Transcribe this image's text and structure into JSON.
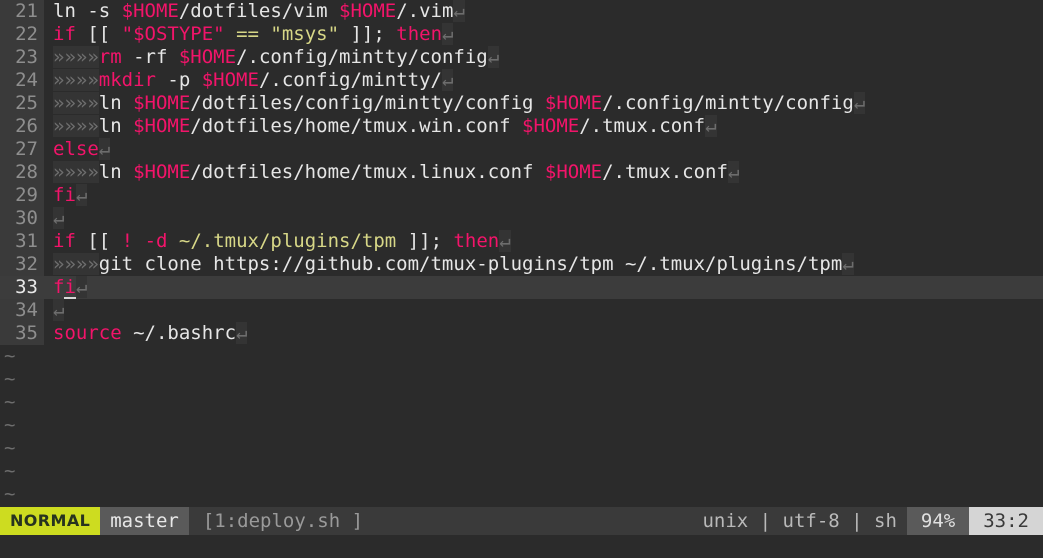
{
  "editor": {
    "name": "vim",
    "colors": {
      "background": "#2b2b2b",
      "gutter_background": "#3a3a3a",
      "cursorline_background": "#3c3c3c",
      "keyword": "#f2146a",
      "variable": "#f2146a",
      "string": "#d7d787",
      "plain_text": "#e6e6e6",
      "line_number": "#8e8e8e",
      "whitespace_marker": "#6e6e6e",
      "statusline_background": "#3a3a3a",
      "mode_background": "#cddc20",
      "mode_text": "#27331f"
    },
    "indent_marker": "»",
    "eol_marker": "↵",
    "tilde_marker": "~",
    "tilde_line_count": 7,
    "cursor_line_number": 33
  },
  "buffer": {
    "lines": [
      {
        "number": "21",
        "cursorline": false,
        "tokens": [
          {
            "text": "ln -s ",
            "type": "plain"
          },
          {
            "text": "$HOME",
            "type": "var"
          },
          {
            "text": "/dotfiles/vim ",
            "type": "plain"
          },
          {
            "text": "$HOME",
            "type": "var"
          },
          {
            "text": "/.vim",
            "type": "plain"
          },
          {
            "text": "↵",
            "type": "eol"
          }
        ]
      },
      {
        "number": "22",
        "cursorline": false,
        "tokens": [
          {
            "text": "if",
            "type": "kw"
          },
          {
            "text": " [[ ",
            "type": "plain"
          },
          {
            "text": "\"$OSTYPE\"",
            "type": "var"
          },
          {
            "text": " ",
            "type": "plain"
          },
          {
            "text": "==",
            "type": "op"
          },
          {
            "text": " ",
            "type": "plain"
          },
          {
            "text": "\"msys\"",
            "type": "str"
          },
          {
            "text": " ]]; ",
            "type": "plain"
          },
          {
            "text": "then",
            "type": "kw"
          },
          {
            "text": "↵",
            "type": "eol"
          }
        ]
      },
      {
        "number": "23",
        "cursorline": false,
        "tokens": [
          {
            "text": "»»»»",
            "type": "indent"
          },
          {
            "text": "rm",
            "type": "kw"
          },
          {
            "text": " -rf ",
            "type": "plain"
          },
          {
            "text": "$HOME",
            "type": "var"
          },
          {
            "text": "/.config/mintty/config",
            "type": "plain"
          },
          {
            "text": "↵",
            "type": "eol"
          }
        ]
      },
      {
        "number": "24",
        "cursorline": false,
        "tokens": [
          {
            "text": "»»»»",
            "type": "indent"
          },
          {
            "text": "mkdir",
            "type": "kw"
          },
          {
            "text": " -p ",
            "type": "plain"
          },
          {
            "text": "$HOME",
            "type": "var"
          },
          {
            "text": "/.config/mintty/",
            "type": "plain"
          },
          {
            "text": "↵",
            "type": "eol"
          }
        ]
      },
      {
        "number": "25",
        "cursorline": false,
        "tokens": [
          {
            "text": "»»»»",
            "type": "indent"
          },
          {
            "text": "ln ",
            "type": "plain"
          },
          {
            "text": "$HOME",
            "type": "var"
          },
          {
            "text": "/dotfiles/config/mintty/config ",
            "type": "plain"
          },
          {
            "text": "$HOME",
            "type": "var"
          },
          {
            "text": "/.config/mintty/config",
            "type": "plain"
          },
          {
            "text": "↵",
            "type": "eol"
          }
        ]
      },
      {
        "number": "26",
        "cursorline": false,
        "tokens": [
          {
            "text": "»»»»",
            "type": "indent"
          },
          {
            "text": "ln ",
            "type": "plain"
          },
          {
            "text": "$HOME",
            "type": "var"
          },
          {
            "text": "/dotfiles/home/tmux.win.conf ",
            "type": "plain"
          },
          {
            "text": "$HOME",
            "type": "var"
          },
          {
            "text": "/.tmux.conf",
            "type": "plain"
          },
          {
            "text": "↵",
            "type": "eol"
          }
        ]
      },
      {
        "number": "27",
        "cursorline": false,
        "tokens": [
          {
            "text": "else",
            "type": "kw"
          },
          {
            "text": "↵",
            "type": "eol"
          }
        ]
      },
      {
        "number": "28",
        "cursorline": false,
        "tokens": [
          {
            "text": "»»»»",
            "type": "indent"
          },
          {
            "text": "ln ",
            "type": "plain"
          },
          {
            "text": "$HOME",
            "type": "var"
          },
          {
            "text": "/dotfiles/home/tmux.linux.conf ",
            "type": "plain"
          },
          {
            "text": "$HOME",
            "type": "var"
          },
          {
            "text": "/.tmux.conf",
            "type": "plain"
          },
          {
            "text": "↵",
            "type": "eol"
          }
        ]
      },
      {
        "number": "29",
        "cursorline": false,
        "tokens": [
          {
            "text": "fi",
            "type": "kw"
          },
          {
            "text": "↵",
            "type": "eol"
          }
        ]
      },
      {
        "number": "30",
        "cursorline": false,
        "tokens": [
          {
            "text": "↵",
            "type": "eol"
          }
        ]
      },
      {
        "number": "31",
        "cursorline": false,
        "tokens": [
          {
            "text": "if",
            "type": "kw"
          },
          {
            "text": " [[ ",
            "type": "plain"
          },
          {
            "text": "!",
            "type": "kw"
          },
          {
            "text": " ",
            "type": "plain"
          },
          {
            "text": "-d",
            "type": "kw"
          },
          {
            "text": " ",
            "type": "plain"
          },
          {
            "text": "~/.tmux/plugins/tpm",
            "type": "str"
          },
          {
            "text": " ]]; ",
            "type": "plain"
          },
          {
            "text": "then",
            "type": "kw"
          },
          {
            "text": "↵",
            "type": "eol"
          }
        ]
      },
      {
        "number": "32",
        "cursorline": false,
        "tokens": [
          {
            "text": "»»»»",
            "type": "indent"
          },
          {
            "text": "git clone https://github.com/tmux-plugins/tpm ~/.tmux/plugins/tpm",
            "type": "plain"
          },
          {
            "text": "↵",
            "type": "eol"
          }
        ]
      },
      {
        "number": "33",
        "cursorline": true,
        "tokens": [
          {
            "text": "f",
            "type": "kw"
          },
          {
            "text": "i",
            "type": "kw-cursor"
          },
          {
            "text": "↵",
            "type": "eol"
          }
        ]
      },
      {
        "number": "34",
        "cursorline": false,
        "tokens": [
          {
            "text": "↵",
            "type": "eol"
          }
        ]
      },
      {
        "number": "35",
        "cursorline": false,
        "tokens": [
          {
            "text": "source",
            "type": "kw"
          },
          {
            "text": " ~/.bashrc",
            "type": "plain"
          },
          {
            "text": "↵",
            "type": "eol"
          }
        ]
      }
    ]
  },
  "statusline": {
    "mode": "NORMAL",
    "branch": "master",
    "file": "[1:deploy.sh ]",
    "fileformat": "unix",
    "encoding": "utf-8",
    "filetype": "sh",
    "fileinfo": "unix | utf-8 | sh",
    "percent": "94%",
    "position": "33:2"
  }
}
